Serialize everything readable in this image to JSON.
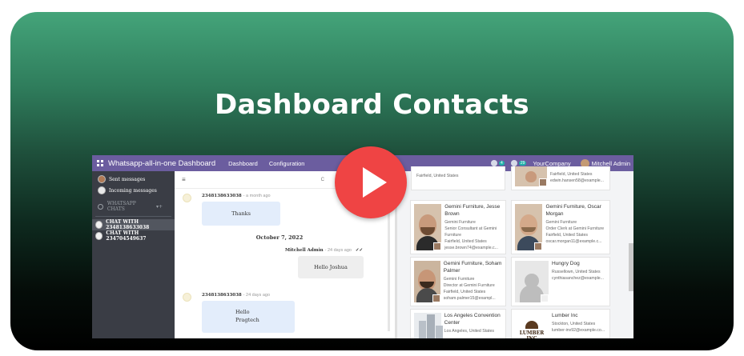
{
  "headline": "Dashboard Contacts",
  "colors": {
    "topbar": "#6b5d9f",
    "play": "#ef4444",
    "sidebar": "#3a3d45"
  },
  "topbar": {
    "app_title": "Whatsapp-all-in-one Dashboard",
    "menu": [
      "Dashboard",
      "Configuration"
    ],
    "chat_badge": "4",
    "activity_badge": "29",
    "company": "YourCompany",
    "user": "Mitchell Admin"
  },
  "sidebar": {
    "items": [
      "Sent messages",
      "Incoming messages"
    ],
    "section": "WHATSAPP CHATS",
    "chats": [
      "CHAT WITH 2348138633038",
      "CHAT WITH 234704549637"
    ]
  },
  "chat": {
    "header_text": "C",
    "messages": [
      {
        "sender": "2348138633038",
        "ago": "- a month ago",
        "text": "Thanks"
      },
      {
        "sender": "Mitchell Admin",
        "ago": "- 24 days ago",
        "text": "Hello Joshua"
      },
      {
        "sender": "2348138633038",
        "ago": "- 24 days ago",
        "text_line1": "Hello",
        "text_line2": "Pragtech"
      }
    ],
    "date_separator": "October 7, 2022"
  },
  "contacts": [
    {
      "name": "",
      "company": "",
      "role": "Fairfield, United States",
      "location": "edwin.hansen58@example...",
      "email": ""
    },
    {
      "name": "Gemini Furniture, Jesse Brown",
      "company": "Gemini Furniture",
      "role": "Senior Consultant at Gemini Furniture",
      "location": "Fairfield, United States",
      "email": "jesse.brown74@example.c..."
    },
    {
      "name": "Gemini Furniture, Oscar Morgan",
      "company": "Gemini Furniture",
      "role": "Order Clerk at Gemini Furniture",
      "location": "Fairfield, United States",
      "email": "oscar.morgan11@example.c..."
    },
    {
      "name": "Gemini Furniture, Soham Palmer",
      "company": "Gemini Furniture",
      "role": "Director at Gemini Furniture",
      "location": "Fairfield, United States",
      "email": "soham.palmer15@exampl..."
    },
    {
      "name": "Hungry Dog",
      "company": "",
      "role": "",
      "location": "Russellown, United States",
      "email": "cynthiasanchez@example..."
    },
    {
      "name": "Los Angeles Convention Center",
      "company": "",
      "role": "",
      "location": "Los Angeles, United States",
      "email": ""
    },
    {
      "name": "Lumber Inc",
      "company": "",
      "role": "",
      "location": "Stockton, United States",
      "email": "lumber-inv92@example.co..."
    }
  ],
  "logo_lettering": "LUMBER INC"
}
